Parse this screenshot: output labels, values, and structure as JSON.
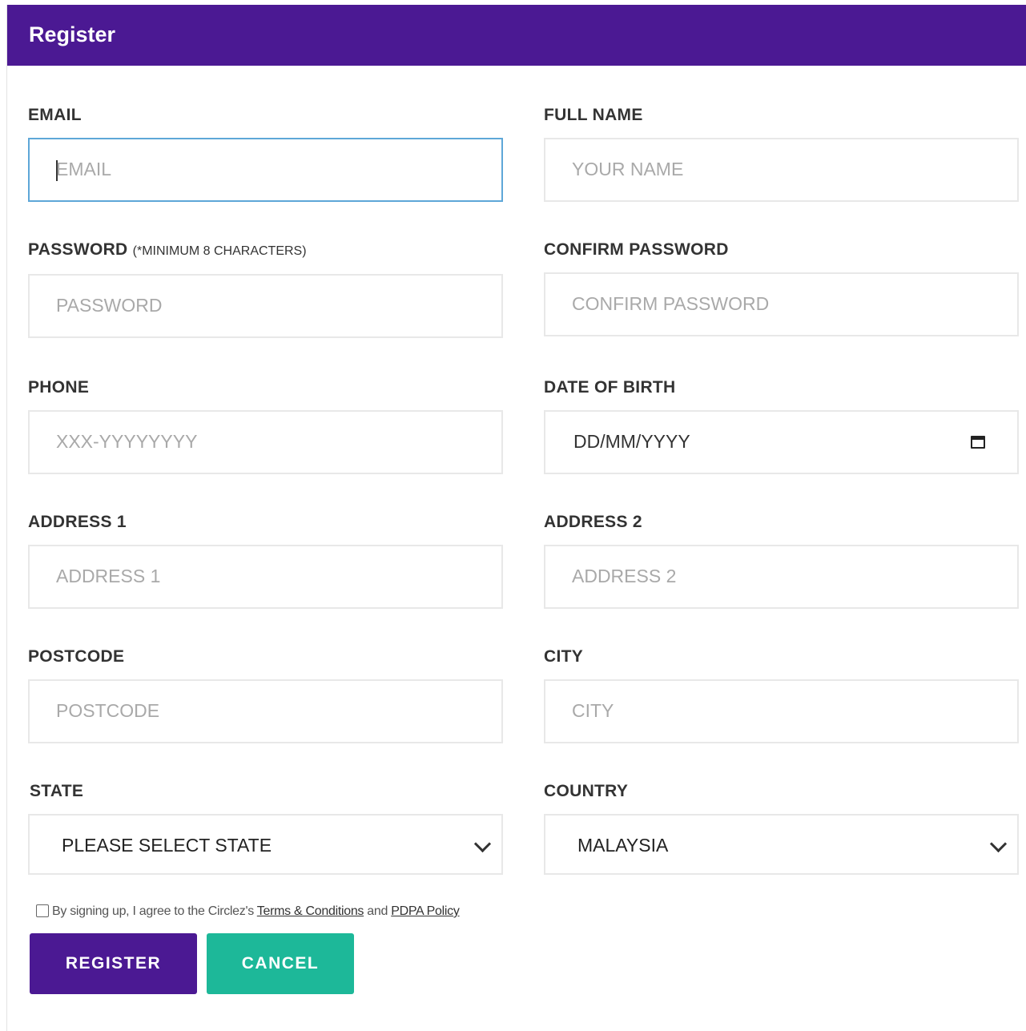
{
  "header": {
    "title": "Register"
  },
  "fields": {
    "email": {
      "label": "EMAIL",
      "placeholder": "EMAIL"
    },
    "full_name": {
      "label": "FULL NAME",
      "placeholder": "YOUR NAME"
    },
    "password": {
      "label": "PASSWORD",
      "hint": "(*MINIMUM 8 CHARACTERS)",
      "placeholder": "PASSWORD"
    },
    "confirm_password": {
      "label": "CONFIRM PASSWORD",
      "placeholder": "CONFIRM PASSWORD"
    },
    "phone": {
      "label": "PHONE",
      "placeholder": "XXX-YYYYYYYY"
    },
    "dob": {
      "label": "DATE OF BIRTH",
      "value": "DD/MM/YYYY",
      "icon": "calendar-icon"
    },
    "address1": {
      "label": "ADDRESS 1",
      "placeholder": "ADDRESS 1"
    },
    "address2": {
      "label": "ADDRESS 2",
      "placeholder": "ADDRESS 2"
    },
    "postcode": {
      "label": "POSTCODE",
      "placeholder": "POSTCODE"
    },
    "city": {
      "label": "CITY",
      "placeholder": "CITY"
    },
    "state": {
      "label": "STATE",
      "value": "PLEASE SELECT STATE",
      "icon": "chevron-down-icon"
    },
    "country": {
      "label": "COUNTRY",
      "value": "MALAYSIA",
      "icon": "chevron-down-icon"
    }
  },
  "agreement": {
    "text": "By signing up, I agree to the Circlez's",
    "terms_link": "Terms & Conditions",
    "and": "and",
    "pdpa_link": "PDPA Policy",
    "checked": false
  },
  "buttons": {
    "register": "REGISTER",
    "cancel": "CANCEL"
  },
  "colors": {
    "brand": "#4b1993",
    "cancel": "#1db899",
    "focus_border": "#5ea7d8"
  }
}
